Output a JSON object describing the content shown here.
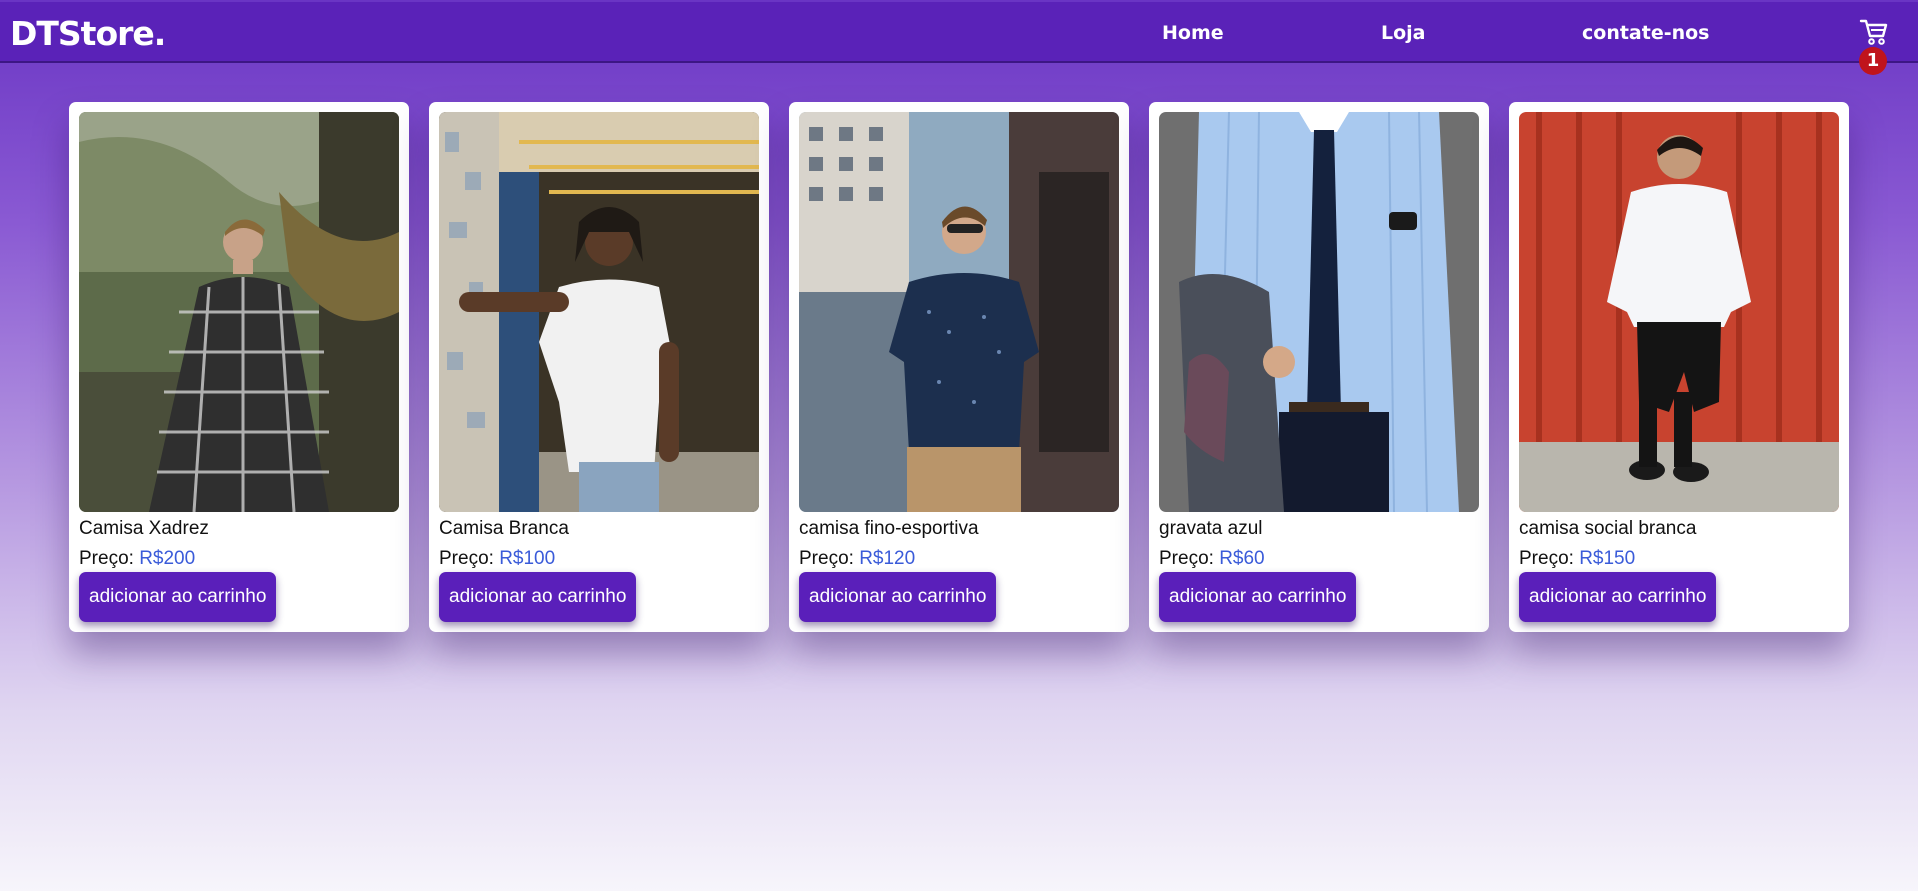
{
  "brand": {
    "logo": "DTStore."
  },
  "nav": {
    "links": [
      {
        "label": "Home"
      },
      {
        "label": "Loja"
      },
      {
        "label": "contate-nos"
      }
    ],
    "cart_count": "1"
  },
  "products": [
    {
      "name": "Camisa Xadrez",
      "price_label": "Preço:",
      "price": "R$200",
      "button": "adicionar ao carrinho"
    },
    {
      "name": "Camisa Branca",
      "price_label": "Preço:",
      "price": "R$100",
      "button": "adicionar ao carrinho"
    },
    {
      "name": "camisa fino-esportiva",
      "price_label": "Preço:",
      "price": "R$120",
      "button": "adicionar ao carrinho"
    },
    {
      "name": "gravata azul",
      "price_label": "Preço:",
      "price": "R$60",
      "button": "adicionar ao carrinho"
    },
    {
      "name": "camisa social branca",
      "price_label": "Preço:",
      "price": "R$150",
      "button": "adicionar ao carrinho"
    }
  ],
  "colors": {
    "navbar": "#5a22b8",
    "button": "#5a1fba",
    "price": "#3a5bd9",
    "badge": "#c0141c"
  },
  "icons": {
    "cart": "shopping-cart-icon"
  }
}
